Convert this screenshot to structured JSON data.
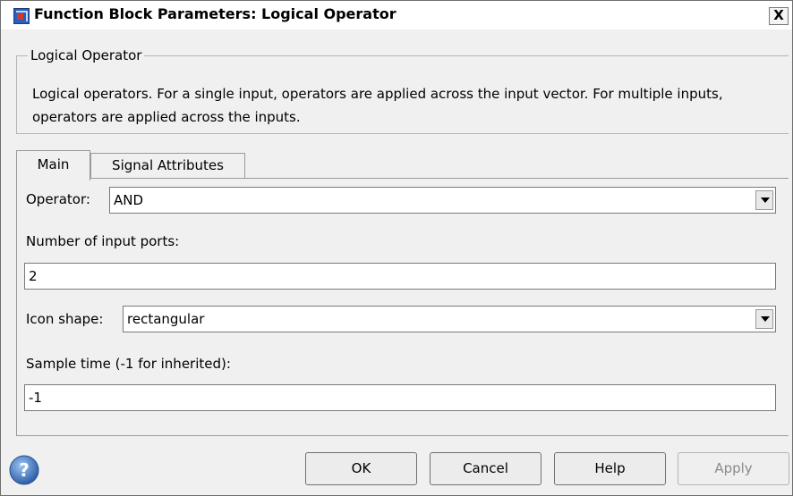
{
  "window": {
    "title": "Function Block Parameters: Logical Operator",
    "close_label": "X"
  },
  "group": {
    "title": "Logical Operator",
    "description": "Logical operators.  For a single input, operators are applied across the input vector.  For multiple inputs, operators are applied across the inputs."
  },
  "tabs": [
    {
      "label": "Main",
      "selected": true
    },
    {
      "label": "Signal Attributes",
      "selected": false
    }
  ],
  "params": {
    "operator_label": "Operator:",
    "operator_value": "AND",
    "num_inputs_label": "Number of input ports:",
    "num_inputs_value": "2",
    "icon_shape_label": "Icon shape:",
    "icon_shape_value": "rectangular",
    "sample_time_label": "Sample time (-1 for inherited):",
    "sample_time_value": "-1"
  },
  "buttons": {
    "ok": "OK",
    "cancel": "Cancel",
    "help": "Help",
    "apply": "Apply"
  },
  "colors": {
    "help_icon": "#3a6fb8",
    "app_icon": "#2a5fc0",
    "apply_disabled_text": "#8a8a8a"
  }
}
